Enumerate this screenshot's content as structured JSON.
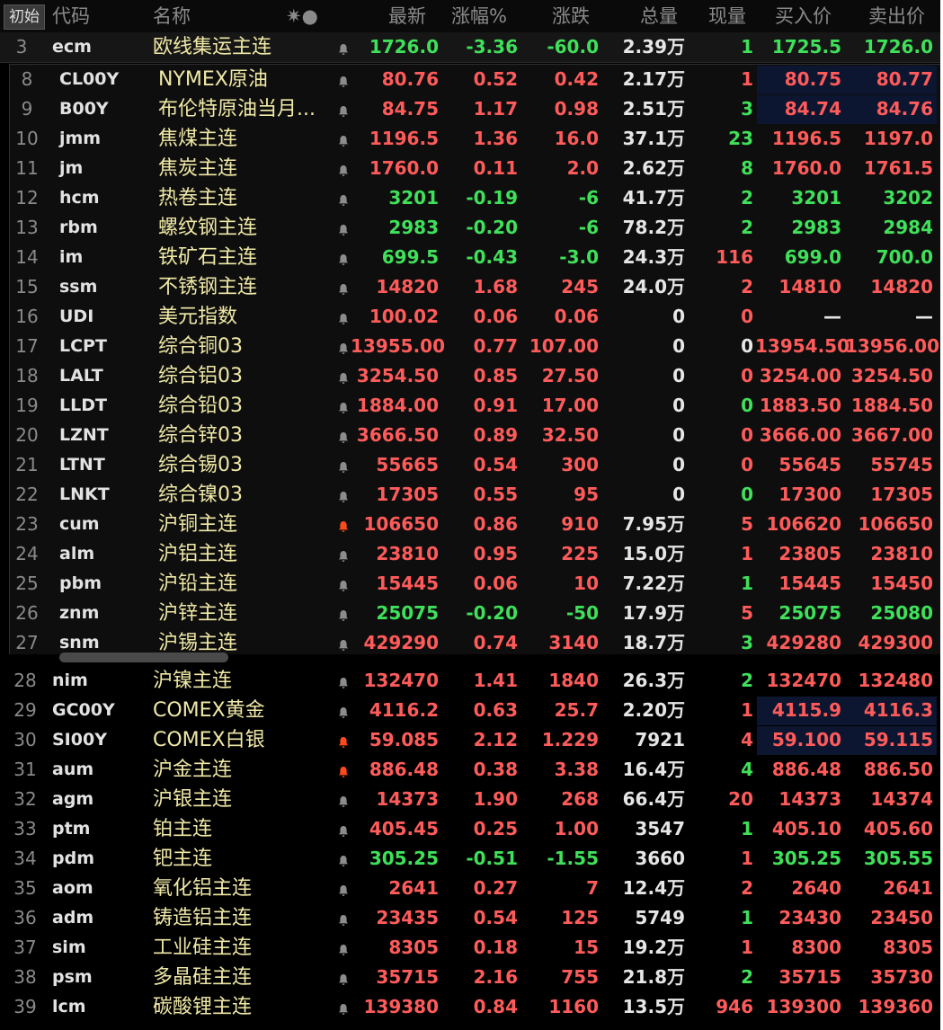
{
  "header": {
    "button": "初始",
    "cols": [
      "代码",
      "名称",
      "最新",
      "涨幅%",
      "涨跌",
      "总量",
      "现量",
      "买入价",
      "卖出价"
    ],
    "sort_icon": "✷●"
  },
  "top_row": {
    "idx": "3",
    "code": "ecm",
    "name": "欧线集运主连",
    "last": "1726.0",
    "pct": "-3.36",
    "chg": "-60.0",
    "vol": "2.39万",
    "cur": "1",
    "bid": "1725.5",
    "ask": "1726.0",
    "dir": "dn",
    "curdir": "dn",
    "bell": "gray"
  },
  "section1": [
    {
      "idx": "8",
      "code": "CL00Y",
      "name": "NYMEX原油",
      "last": "80.76",
      "pct": "0.52",
      "chg": "0.42",
      "vol": "2.17万",
      "cur": "1",
      "bid": "80.75",
      "ask": "80.77",
      "dir": "up",
      "curdir": "up",
      "bell": "gray",
      "hl": true
    },
    {
      "idx": "9",
      "code": "B00Y",
      "name": "布伦特原油当月...",
      "last": "84.75",
      "pct": "1.17",
      "chg": "0.98",
      "vol": "2.51万",
      "cur": "3",
      "bid": "84.74",
      "ask": "84.76",
      "dir": "up",
      "curdir": "dn",
      "bell": "gray",
      "hl": true
    },
    {
      "idx": "10",
      "code": "jmm",
      "name": "焦煤主连",
      "last": "1196.5",
      "pct": "1.36",
      "chg": "16.0",
      "vol": "37.1万",
      "cur": "23",
      "bid": "1196.5",
      "ask": "1197.0",
      "dir": "up",
      "curdir": "dn",
      "bell": "gray"
    },
    {
      "idx": "11",
      "code": "jm",
      "name": "焦炭主连",
      "last": "1760.0",
      "pct": "0.11",
      "chg": "2.0",
      "vol": "2.62万",
      "cur": "8",
      "bid": "1760.0",
      "ask": "1761.5",
      "dir": "up",
      "curdir": "dn",
      "bell": "gray"
    },
    {
      "idx": "12",
      "code": "hcm",
      "name": "热卷主连",
      "last": "3201",
      "pct": "-0.19",
      "chg": "-6",
      "vol": "41.7万",
      "cur": "2",
      "bid": "3201",
      "ask": "3202",
      "dir": "dn",
      "curdir": "dn",
      "bell": "gray"
    },
    {
      "idx": "13",
      "code": "rbm",
      "name": "螺纹钢主连",
      "last": "2983",
      "pct": "-0.20",
      "chg": "-6",
      "vol": "78.2万",
      "cur": "2",
      "bid": "2983",
      "ask": "2984",
      "dir": "dn",
      "curdir": "dn",
      "bell": "gray"
    },
    {
      "idx": "14",
      "code": "im",
      "name": "铁矿石主连",
      "last": "699.5",
      "pct": "-0.43",
      "chg": "-3.0",
      "vol": "24.3万",
      "cur": "116",
      "bid": "699.0",
      "ask": "700.0",
      "dir": "dn",
      "curdir": "up",
      "bell": "gray"
    },
    {
      "idx": "15",
      "code": "ssm",
      "name": "不锈钢主连",
      "last": "14820",
      "pct": "1.68",
      "chg": "245",
      "vol": "24.0万",
      "cur": "2",
      "bid": "14810",
      "ask": "14820",
      "dir": "up",
      "curdir": "up",
      "bell": "gray"
    },
    {
      "idx": "16",
      "code": "UDI",
      "name": "美元指数",
      "last": "100.02",
      "pct": "0.06",
      "chg": "0.06",
      "vol": "0",
      "cur": "0",
      "bid": "—",
      "ask": "—",
      "dir": "up",
      "curdir": "up",
      "bell": "gray",
      "bidflat": true
    },
    {
      "idx": "17",
      "code": "LCPT",
      "name": "综合铜03",
      "last": "13955.00",
      "pct": "0.77",
      "chg": "107.00",
      "vol": "0",
      "cur": "0",
      "bid": "13954.50",
      "ask": "13956.00",
      "dir": "up",
      "curdir": "fl",
      "bell": "gray"
    },
    {
      "idx": "18",
      "code": "LALT",
      "name": "综合铝03",
      "last": "3254.50",
      "pct": "0.85",
      "chg": "27.50",
      "vol": "0",
      "cur": "0",
      "bid": "3254.00",
      "ask": "3254.50",
      "dir": "up",
      "curdir": "up",
      "bell": "gray"
    },
    {
      "idx": "19",
      "code": "LLDT",
      "name": "综合铅03",
      "last": "1884.00",
      "pct": "0.91",
      "chg": "17.00",
      "vol": "0",
      "cur": "0",
      "bid": "1883.50",
      "ask": "1884.50",
      "dir": "up",
      "curdir": "dn",
      "bell": "gray"
    },
    {
      "idx": "20",
      "code": "LZNT",
      "name": "综合锌03",
      "last": "3666.50",
      "pct": "0.89",
      "chg": "32.50",
      "vol": "0",
      "cur": "0",
      "bid": "3666.00",
      "ask": "3667.00",
      "dir": "up",
      "curdir": "up",
      "bell": "gray"
    },
    {
      "idx": "21",
      "code": "LTNT",
      "name": "综合锡03",
      "last": "55665",
      "pct": "0.54",
      "chg": "300",
      "vol": "0",
      "cur": "0",
      "bid": "55645",
      "ask": "55745",
      "dir": "up",
      "curdir": "up",
      "bell": "gray"
    },
    {
      "idx": "22",
      "code": "LNKT",
      "name": "综合镍03",
      "last": "17305",
      "pct": "0.55",
      "chg": "95",
      "vol": "0",
      "cur": "0",
      "bid": "17300",
      "ask": "17305",
      "dir": "up",
      "curdir": "dn",
      "bell": "gray"
    },
    {
      "idx": "23",
      "code": "cum",
      "name": "沪铜主连",
      "last": "106650",
      "pct": "0.86",
      "chg": "910",
      "vol": "7.95万",
      "cur": "5",
      "bid": "106620",
      "ask": "106650",
      "dir": "up",
      "curdir": "up",
      "bell": "red"
    },
    {
      "idx": "24",
      "code": "alm",
      "name": "沪铝主连",
      "last": "23810",
      "pct": "0.95",
      "chg": "225",
      "vol": "15.0万",
      "cur": "1",
      "bid": "23805",
      "ask": "23810",
      "dir": "up",
      "curdir": "up",
      "bell": "gray"
    },
    {
      "idx": "25",
      "code": "pbm",
      "name": "沪铅主连",
      "last": "15445",
      "pct": "0.06",
      "chg": "10",
      "vol": "7.22万",
      "cur": "1",
      "bid": "15445",
      "ask": "15450",
      "dir": "up",
      "curdir": "dn",
      "bell": "gray"
    },
    {
      "idx": "26",
      "code": "znm",
      "name": "沪锌主连",
      "last": "25075",
      "pct": "-0.20",
      "chg": "-50",
      "vol": "17.9万",
      "cur": "5",
      "bid": "25075",
      "ask": "25080",
      "dir": "dn",
      "curdir": "up",
      "bell": "gray"
    },
    {
      "idx": "27",
      "code": "snm",
      "name": "沪锡主连",
      "last": "429290",
      "pct": "0.74",
      "chg": "3140",
      "vol": "18.7万",
      "cur": "3",
      "bid": "429280",
      "ask": "429300",
      "dir": "up",
      "curdir": "dn",
      "bell": "gray"
    }
  ],
  "section2": [
    {
      "idx": "28",
      "code": "nim",
      "name": "沪镍主连",
      "last": "132470",
      "pct": "1.41",
      "chg": "1840",
      "vol": "26.3万",
      "cur": "2",
      "bid": "132470",
      "ask": "132480",
      "dir": "up",
      "curdir": "dn",
      "bell": "gray"
    },
    {
      "idx": "29",
      "code": "GC00Y",
      "name": "COMEX黄金",
      "last": "4116.2",
      "pct": "0.63",
      "chg": "25.7",
      "vol": "2.20万",
      "cur": "1",
      "bid": "4115.9",
      "ask": "4116.3",
      "dir": "up",
      "curdir": "up",
      "bell": "gray",
      "hl": true
    },
    {
      "idx": "30",
      "code": "SI00Y",
      "name": "COMEX白银",
      "last": "59.085",
      "pct": "2.12",
      "chg": "1.229",
      "vol": "7921",
      "cur": "4",
      "bid": "59.100",
      "ask": "59.115",
      "dir": "up",
      "curdir": "up",
      "bell": "red",
      "hl": true
    },
    {
      "idx": "31",
      "code": "aum",
      "name": "沪金主连",
      "last": "886.48",
      "pct": "0.38",
      "chg": "3.38",
      "vol": "16.4万",
      "cur": "4",
      "bid": "886.48",
      "ask": "886.50",
      "dir": "up",
      "curdir": "dn",
      "bell": "red"
    },
    {
      "idx": "32",
      "code": "agm",
      "name": "沪银主连",
      "last": "14373",
      "pct": "1.90",
      "chg": "268",
      "vol": "66.4万",
      "cur": "20",
      "bid": "14373",
      "ask": "14374",
      "dir": "up",
      "curdir": "up",
      "bell": "gray"
    },
    {
      "idx": "33",
      "code": "ptm",
      "name": "铂主连",
      "last": "405.45",
      "pct": "0.25",
      "chg": "1.00",
      "vol": "3547",
      "cur": "1",
      "bid": "405.10",
      "ask": "405.60",
      "dir": "up",
      "curdir": "dn",
      "bell": "gray"
    },
    {
      "idx": "34",
      "code": "pdm",
      "name": "钯主连",
      "last": "305.25",
      "pct": "-0.51",
      "chg": "-1.55",
      "vol": "3660",
      "cur": "1",
      "bid": "305.25",
      "ask": "305.55",
      "dir": "dn",
      "curdir": "up",
      "bell": "gray"
    },
    {
      "idx": "35",
      "code": "aom",
      "name": "氧化铝主连",
      "last": "2641",
      "pct": "0.27",
      "chg": "7",
      "vol": "12.4万",
      "cur": "2",
      "bid": "2640",
      "ask": "2641",
      "dir": "up",
      "curdir": "up",
      "bell": "gray"
    },
    {
      "idx": "36",
      "code": "adm",
      "name": "铸造铝主连",
      "last": "23435",
      "pct": "0.54",
      "chg": "125",
      "vol": "5749",
      "cur": "1",
      "bid": "23430",
      "ask": "23450",
      "dir": "up",
      "curdir": "dn",
      "bell": "gray"
    },
    {
      "idx": "37",
      "code": "sim",
      "name": "工业硅主连",
      "last": "8305",
      "pct": "0.18",
      "chg": "15",
      "vol": "19.2万",
      "cur": "1",
      "bid": "8300",
      "ask": "8305",
      "dir": "up",
      "curdir": "up",
      "bell": "gray"
    },
    {
      "idx": "38",
      "code": "psm",
      "name": "多晶硅主连",
      "last": "35715",
      "pct": "2.16",
      "chg": "755",
      "vol": "21.8万",
      "cur": "2",
      "bid": "35715",
      "ask": "35730",
      "dir": "up",
      "curdir": "dn",
      "bell": "gray"
    },
    {
      "idx": "39",
      "code": "lcm",
      "name": "碳酸锂主连",
      "last": "139380",
      "pct": "0.84",
      "chg": "1160",
      "vol": "13.5万",
      "cur": "946",
      "bid": "139300",
      "ask": "139360",
      "dir": "up",
      "curdir": "up",
      "bell": "gray"
    }
  ],
  "colors": {
    "up": "#ff5b5b",
    "down": "#3fe05a",
    "name": "#f0e9a6",
    "bell_red": "#ff4a1c",
    "bell_gray": "#8c8c8c",
    "highlight": "#0d1630"
  }
}
